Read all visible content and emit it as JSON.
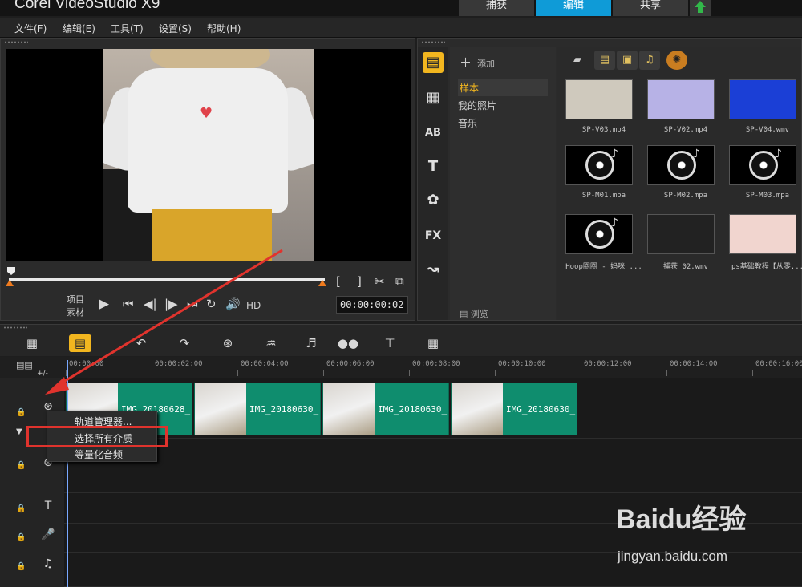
{
  "app": {
    "title": "Corel VideoStudio X9"
  },
  "mode_tabs": [
    {
      "label": "捕获",
      "active": false
    },
    {
      "label": "编辑",
      "active": true
    },
    {
      "label": "共享",
      "active": false
    }
  ],
  "menubar": [
    "文件(F)",
    "编辑(E)",
    "工具(T)",
    "设置(S)",
    "帮助(H)"
  ],
  "player": {
    "mode_project": "项目",
    "mode_clip": "素材",
    "hd_label": "HD",
    "timecode": "00:00:00:02",
    "bracket_in": "[",
    "bracket_out": "]"
  },
  "library": {
    "add_label": "添加",
    "browse_label": "浏览",
    "folders": [
      {
        "label": "样本",
        "selected": true
      },
      {
        "label": "我的照片",
        "selected": false
      },
      {
        "label": "音乐",
        "selected": false
      }
    ],
    "tool_icons": [
      "media-icon",
      "instant-project-icon",
      "title-icon-ab",
      "text-icon",
      "transition-icon",
      "fx-icon",
      "path-icon"
    ],
    "thumbnails": [
      {
        "caption": "SP-V03.mp4",
        "kind": "video",
        "color": "#cfc9bd"
      },
      {
        "caption": "SP-V02.mp4",
        "kind": "video",
        "color": "#b7b2e6"
      },
      {
        "caption": "SP-V04.wmv",
        "kind": "video",
        "color": "#1b3fd6"
      },
      {
        "caption": "SP-M01.mpa",
        "kind": "audio",
        "color": "#000000"
      },
      {
        "caption": "SP-M02.mpa",
        "kind": "audio",
        "color": "#000000"
      },
      {
        "caption": "SP-M03.mpa",
        "kind": "audio",
        "color": "#000000"
      },
      {
        "caption": "Hoop圈圈 - 妈咪 ...",
        "kind": "audio",
        "color": "#000000"
      },
      {
        "caption": "捕获 02.wmv",
        "kind": "video",
        "color": "#222222"
      },
      {
        "caption": "ps基础教程【从零...",
        "kind": "video",
        "color": "#f1d5cf"
      }
    ]
  },
  "timeline": {
    "ruler": [
      "00:00:00",
      "00:00:02:00",
      "00:00:04:00",
      "00:00:06:00",
      "00:00:08:00",
      "00:00:10:00",
      "00:00:12:00",
      "00:00:14:00",
      "00:00:16:00"
    ],
    "clips": [
      {
        "label": "IMG_20180628_"
      },
      {
        "label": "IMG_20180630_"
      },
      {
        "label": "IMG_20180630_"
      },
      {
        "label": "IMG_20180630_"
      }
    ],
    "zoom_label": "+/-"
  },
  "context_menu": {
    "items": [
      "轨道管理器...",
      "选择所有介质",
      "等量化音频"
    ],
    "highlighted_index": 1
  },
  "watermark": {
    "logo": "Baidu经验",
    "url": "jingyan.baidu.com"
  },
  "colors": {
    "accent": "#0f9bd7",
    "clip": "#0f8d6e",
    "highlight": "#e0332d",
    "orange": "#f07b1e",
    "yellow": "#f2b61f"
  }
}
